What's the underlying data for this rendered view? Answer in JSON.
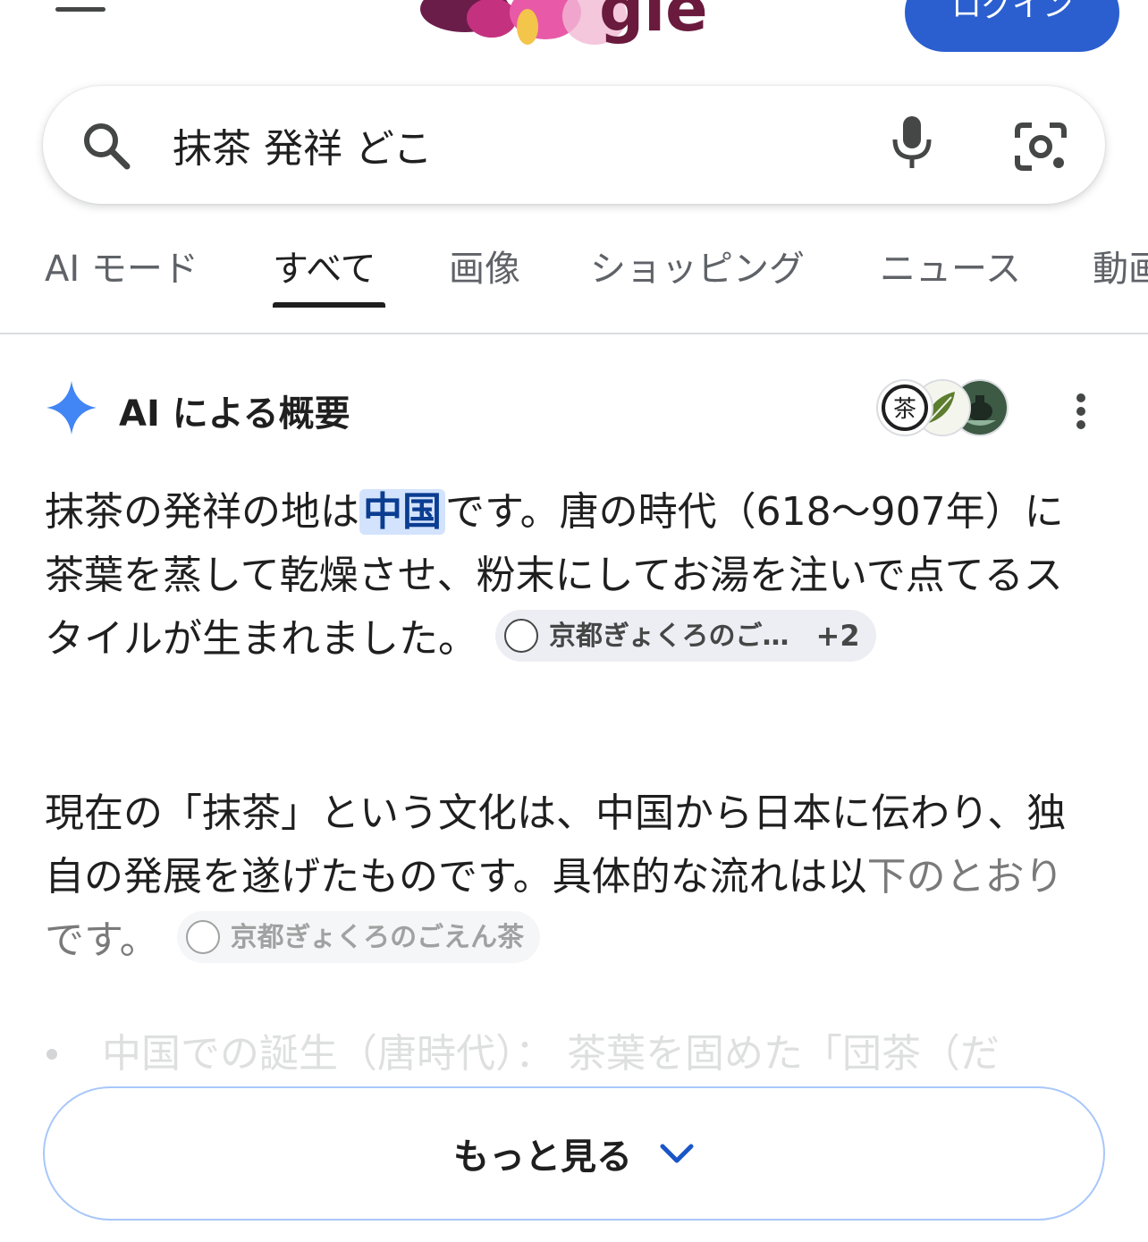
{
  "header": {
    "login_label": "ログイン"
  },
  "search": {
    "query": "抹茶 発祥 どこ"
  },
  "tabs": [
    {
      "label": "AI モード"
    },
    {
      "label": "すべて"
    },
    {
      "label": "画像"
    },
    {
      "label": "ショッピング"
    },
    {
      "label": "ニュース"
    },
    {
      "label": "動画"
    }
  ],
  "ai_overview": {
    "title": "AI による概要",
    "para1": {
      "before": "抹茶の発祥の地は",
      "highlight": "中国",
      "after": "です。唐の時代（618〜907年）に茶葉を蒸して乾燥させ、粉末にしてお湯を注いで点てるスタイルが生まれました。",
      "chip_label": "京都ぎょくろのご…",
      "chip_extra": "+2"
    },
    "para2": {
      "text": "現在の「抹茶」という文化は、中国から日本に伝わり、独自の発展を遂げたものです。具体的な流れは以",
      "dim_text": "下のとおりです。",
      "chip_label": "京都ぎょくろのごえん茶"
    },
    "bullet_preview": "中国での誕生（唐時代）： 茶葉を固めた「団茶（だ",
    "show_more_label": "もっと見る"
  },
  "colors": {
    "accent": "#2b5fd0",
    "highlight_bg": "#d3e3fd",
    "spark": "#4285f4"
  }
}
